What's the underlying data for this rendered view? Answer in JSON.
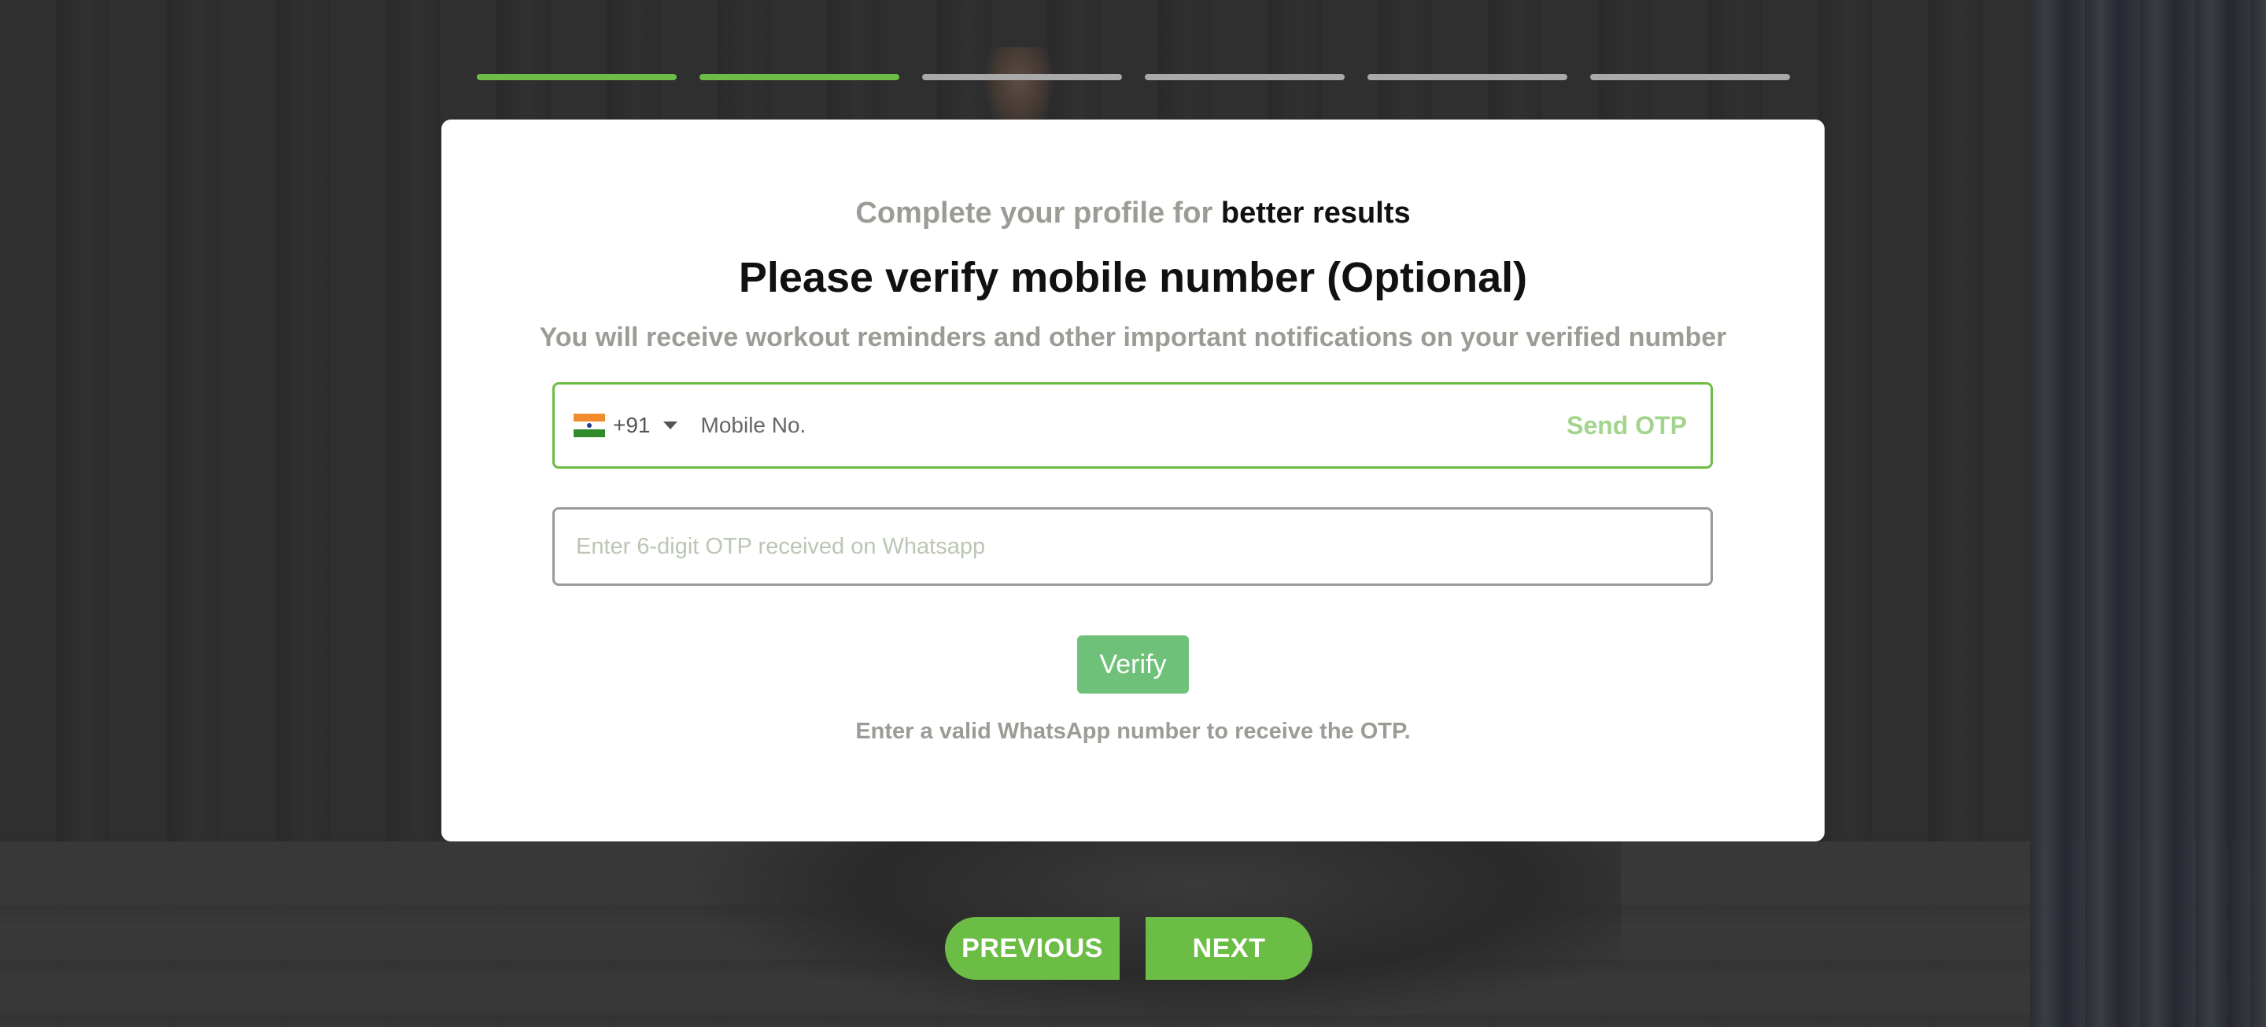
{
  "progress": {
    "steps": [
      {
        "state": "done"
      },
      {
        "state": "done"
      },
      {
        "state": "pending"
      },
      {
        "state": "pending"
      },
      {
        "state": "pending"
      },
      {
        "state": "pending"
      }
    ],
    "active_color": "#6cbd45",
    "inactive_color": "#a9a9a9"
  },
  "card": {
    "subtitle_muted": "Complete your profile for",
    "subtitle_emphasis": "better results",
    "title": "Please verify mobile number (Optional)",
    "description": "You will receive workout reminders and other important notifications on your verified number",
    "phone": {
      "flag_icon": "india-flag-icon",
      "country_code": "+91",
      "value": "",
      "placeholder": "Mobile No.",
      "send_otp_label": "Send OTP"
    },
    "otp": {
      "value": "",
      "placeholder": "Enter 6-digit OTP received on Whatsapp"
    },
    "verify_label": "Verify",
    "hint": "Enter a valid WhatsApp number to receive the OTP."
  },
  "nav": {
    "previous_label": "PREVIOUS",
    "next_label": "NEXT"
  },
  "colors": {
    "brand_green": "#6cbd45",
    "verify_green": "#6fc17a",
    "muted_text": "#9a9d95"
  }
}
